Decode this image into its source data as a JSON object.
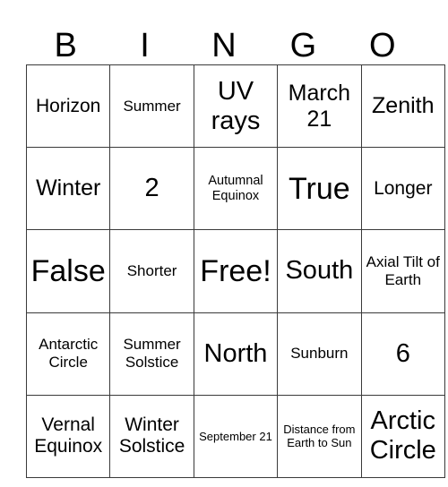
{
  "card": {
    "headers": [
      "B",
      "I",
      "N",
      "G",
      "O"
    ],
    "rows": [
      [
        {
          "text": "Horizon",
          "size": "fs-lg"
        },
        {
          "text": "Summer",
          "size": "fs-md"
        },
        {
          "text": "UV rays",
          "size": "fs-xxl"
        },
        {
          "text": "March 21",
          "size": "fs-xl"
        },
        {
          "text": "Zenith",
          "size": "fs-xl"
        }
      ],
      [
        {
          "text": "Winter",
          "size": "fs-xl"
        },
        {
          "text": "2",
          "size": "fs-xxl"
        },
        {
          "text": "Autumnal Equinox",
          "size": "fs-sm"
        },
        {
          "text": "True",
          "size": "fs-huge"
        },
        {
          "text": "Longer",
          "size": "fs-lg"
        }
      ],
      [
        {
          "text": "False",
          "size": "fs-huge"
        },
        {
          "text": "Shorter",
          "size": "fs-md"
        },
        {
          "text": "Free!",
          "size": "fs-huge"
        },
        {
          "text": "South",
          "size": "fs-xxl"
        },
        {
          "text": "Axial Tilt of Earth",
          "size": "fs-md"
        }
      ],
      [
        {
          "text": "Antarctic Circle",
          "size": "fs-md"
        },
        {
          "text": "Summer Solstice",
          "size": "fs-md"
        },
        {
          "text": "North",
          "size": "fs-xxl"
        },
        {
          "text": "Sunburn",
          "size": "fs-md"
        },
        {
          "text": "6",
          "size": "fs-xxl"
        }
      ],
      [
        {
          "text": "Vernal Equinox",
          "size": "fs-lg"
        },
        {
          "text": "Winter Solstice",
          "size": "fs-lg"
        },
        {
          "text": "September 21",
          "size": "fs-xs"
        },
        {
          "text": "Distance from Earth to Sun",
          "size": "fs-xs"
        },
        {
          "text": "Arctic Circle",
          "size": "fs-xxl"
        }
      ]
    ]
  }
}
